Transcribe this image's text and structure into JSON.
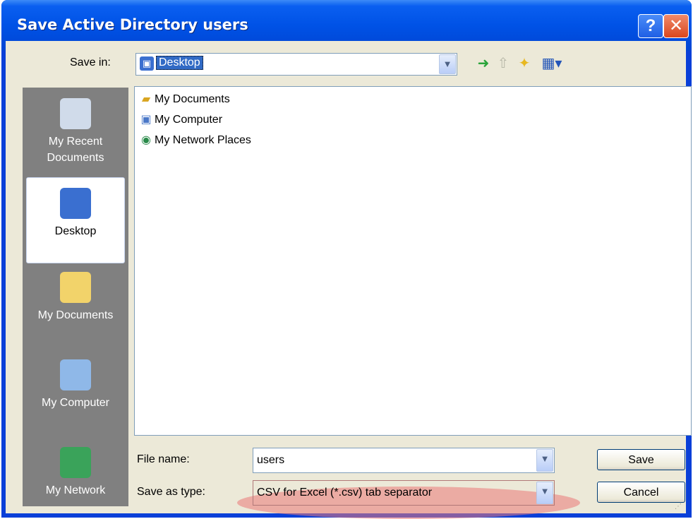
{
  "window": {
    "title": "Save Active Directory users",
    "help_glyph": "?",
    "close_glyph": "✕"
  },
  "toolbar": {
    "save_in_label": "Save in:",
    "save_in_value": "Desktop",
    "back_icon": "back-arrow-icon",
    "up_icon": "up-folder-icon",
    "new_folder_icon": "new-folder-icon",
    "views_icon": "views-menu-icon"
  },
  "places": [
    {
      "label": "My Recent\nDocuments",
      "icon": "recent-documents-icon"
    },
    {
      "label": "Desktop",
      "icon": "desktop-icon",
      "selected": true
    },
    {
      "label": "My Documents",
      "icon": "my-documents-icon"
    },
    {
      "label": "My Computer",
      "icon": "my-computer-icon"
    },
    {
      "label": "My Network",
      "icon": "my-network-icon"
    }
  ],
  "files": [
    {
      "label": "My Documents",
      "icon": "my-documents-icon"
    },
    {
      "label": "My Computer",
      "icon": "my-computer-icon"
    },
    {
      "label": "My Network Places",
      "icon": "network-places-icon"
    }
  ],
  "form": {
    "file_name_label": "File name:",
    "file_name_value": "users",
    "save_as_type_label": "Save as type:",
    "save_as_type_value": "CSV for Excel (*.csv) tab separator"
  },
  "buttons": {
    "save": "Save",
    "cancel": "Cancel"
  },
  "colors": {
    "titlebar": "#0052e6",
    "face": "#ece9d8",
    "selection": "#316ac5",
    "annotation": "#eb7878"
  }
}
